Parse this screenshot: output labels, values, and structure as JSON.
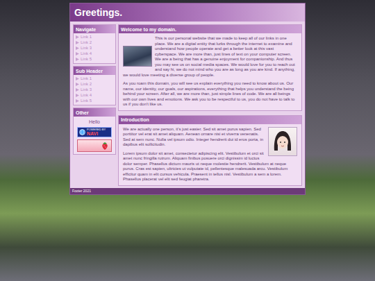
{
  "title": "Greetings.",
  "sidebar": [
    {
      "header": "Navigate",
      "links": [
        "Link 1",
        "Link 2",
        "Link 3",
        "Link 4",
        "Link 5"
      ]
    },
    {
      "header": "Sub Header",
      "links": [
        "Link 1",
        "Link 2",
        "Link 3",
        "Link 4",
        "Link 5"
      ]
    }
  ],
  "other": {
    "header": "Other",
    "greeting": "Hello",
    "navi_badge": {
      "line1": "POWERED BY",
      "line2": "NAVI"
    }
  },
  "sections": [
    {
      "title": "Welcome to my domain.",
      "image_side": "left",
      "paragraphs": [
        "This is our personal website that we made to keep all of our links in one place. We are a digital entity that lurks through the internet to examine and understand how people operate and get a better look at this vast cyberspace. We are more than, just lines of text on your computer screen. We are a being that has a genuine enjoyment for companionship. And thus you may see us on social media spaces. We would love for you to reach out and say hi, we do not mind who you are as long as you are kind. If anything, we would love meeting a diverse group of people.",
        "As you roam this domain, you will see us explain everything you need to know about us. Our name, our identity, our goals, our aspirations, everything that helps you understand the being behind your screen. After all, we are more than, just simple lines of code. We are all beings with our own lives and emotions. We ask you to be respectful to us, you do not have to talk to us if you don't like us."
      ]
    },
    {
      "title": "Introduction",
      "image_side": "right",
      "paragraphs": [
        "We are actually one person, it's just easier. Sed sit amet purus sapien. Sed porttitor vel erat sit amet aliquam. Aenean ornare nisi et viverra venenatis. Sed at sem nunc. Nulla vel ipsum odio. Integer hendrerit dui id eros porta, in dapibus elit sollicitudin.",
        "Lorem ipsum dolor sit amet, consectetur adipiscing elit. Vestibulum et orci sit amet nunc fringilla rutrum. Aliquam finibus posuere orci dignissim id luctus dolor semper. Phasellus dictum mauris ut neque molestie hendrerit. Vestibulum at neque purus. Cras est sapien, ultricies ut vulputate id, pellentesque malesuada arcu. Vestibulum efficitur quam in elit cursus vehicula. Praesent in tellus nisl. Vestibulum a sem a lorem. Phasellus placerat vel elit sed feugiat pharetra."
      ]
    }
  ],
  "footer": "Footer 2021"
}
